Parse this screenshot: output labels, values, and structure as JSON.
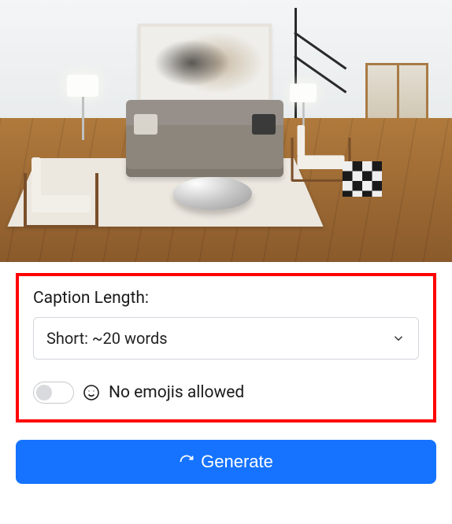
{
  "image": {
    "description": "Modern living room with hardwood floor, gray sofa, abstract wall art, white accent chairs, round silver coffee table, staircase in background"
  },
  "controls": {
    "caption_length_label": "Caption Length:",
    "caption_length_value": "Short: ~20 words",
    "emoji_toggle": {
      "on": false,
      "icon": "smiley-icon",
      "label": "No emojis allowed"
    }
  },
  "actions": {
    "generate_label": "Generate"
  },
  "colors": {
    "accent": "#1573ff",
    "highlight_border": "#ff0000"
  }
}
